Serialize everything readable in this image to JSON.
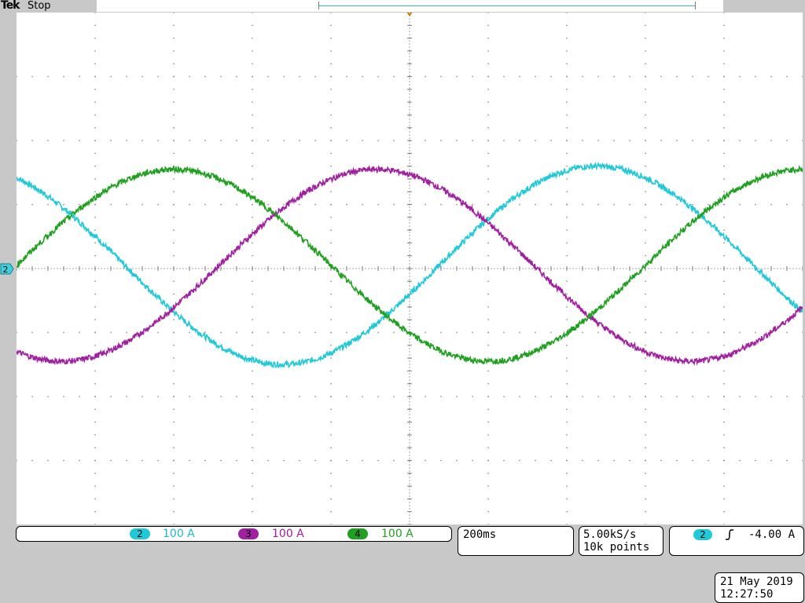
{
  "header": {
    "brand": "Tek",
    "acquisition_status": "Stop"
  },
  "channels": [
    {
      "id": "2",
      "scale": "100 A",
      "color": "#20c8d8",
      "label_color": "#20b8c8"
    },
    {
      "id": "3",
      "scale": "100 A",
      "color": "#a020a0",
      "label_color": "#a020a0"
    },
    {
      "id": "4",
      "scale": "100 A",
      "color": "#20a020",
      "label_color": "#20a020"
    }
  ],
  "ground_marker": {
    "channel": "2"
  },
  "timebase": {
    "scale": "200ms"
  },
  "acquisition": {
    "sample_rate": "5.00kS/s",
    "record_length": "10k points"
  },
  "trigger": {
    "source": "2",
    "slope": "rising",
    "level": "-4.00 A"
  },
  "datetime": {
    "date": "21 May 2019",
    "time": "12:27:50"
  },
  "chart_data": {
    "type": "line",
    "xlabel": "",
    "ylabel": "",
    "x_divisions": 10,
    "y_divisions": 8,
    "xlim": [
      0,
      10
    ],
    "ylim": [
      -4,
      4
    ],
    "grid": true,
    "series": [
      {
        "name": "2",
        "color": "#20c8d8",
        "amplitude_div": 1.55,
        "offset_div": 0.05,
        "period_div": 8.0,
        "phase_deg": 118
      },
      {
        "name": "3",
        "color": "#a020a0",
        "amplitude_div": 1.5,
        "offset_div": 0.05,
        "period_div": 8.0,
        "phase_deg": 244
      },
      {
        "name": "4",
        "color": "#20a020",
        "amplitude_div": 1.5,
        "offset_div": 0.05,
        "period_div": 8.0,
        "phase_deg": 0
      }
    ]
  }
}
